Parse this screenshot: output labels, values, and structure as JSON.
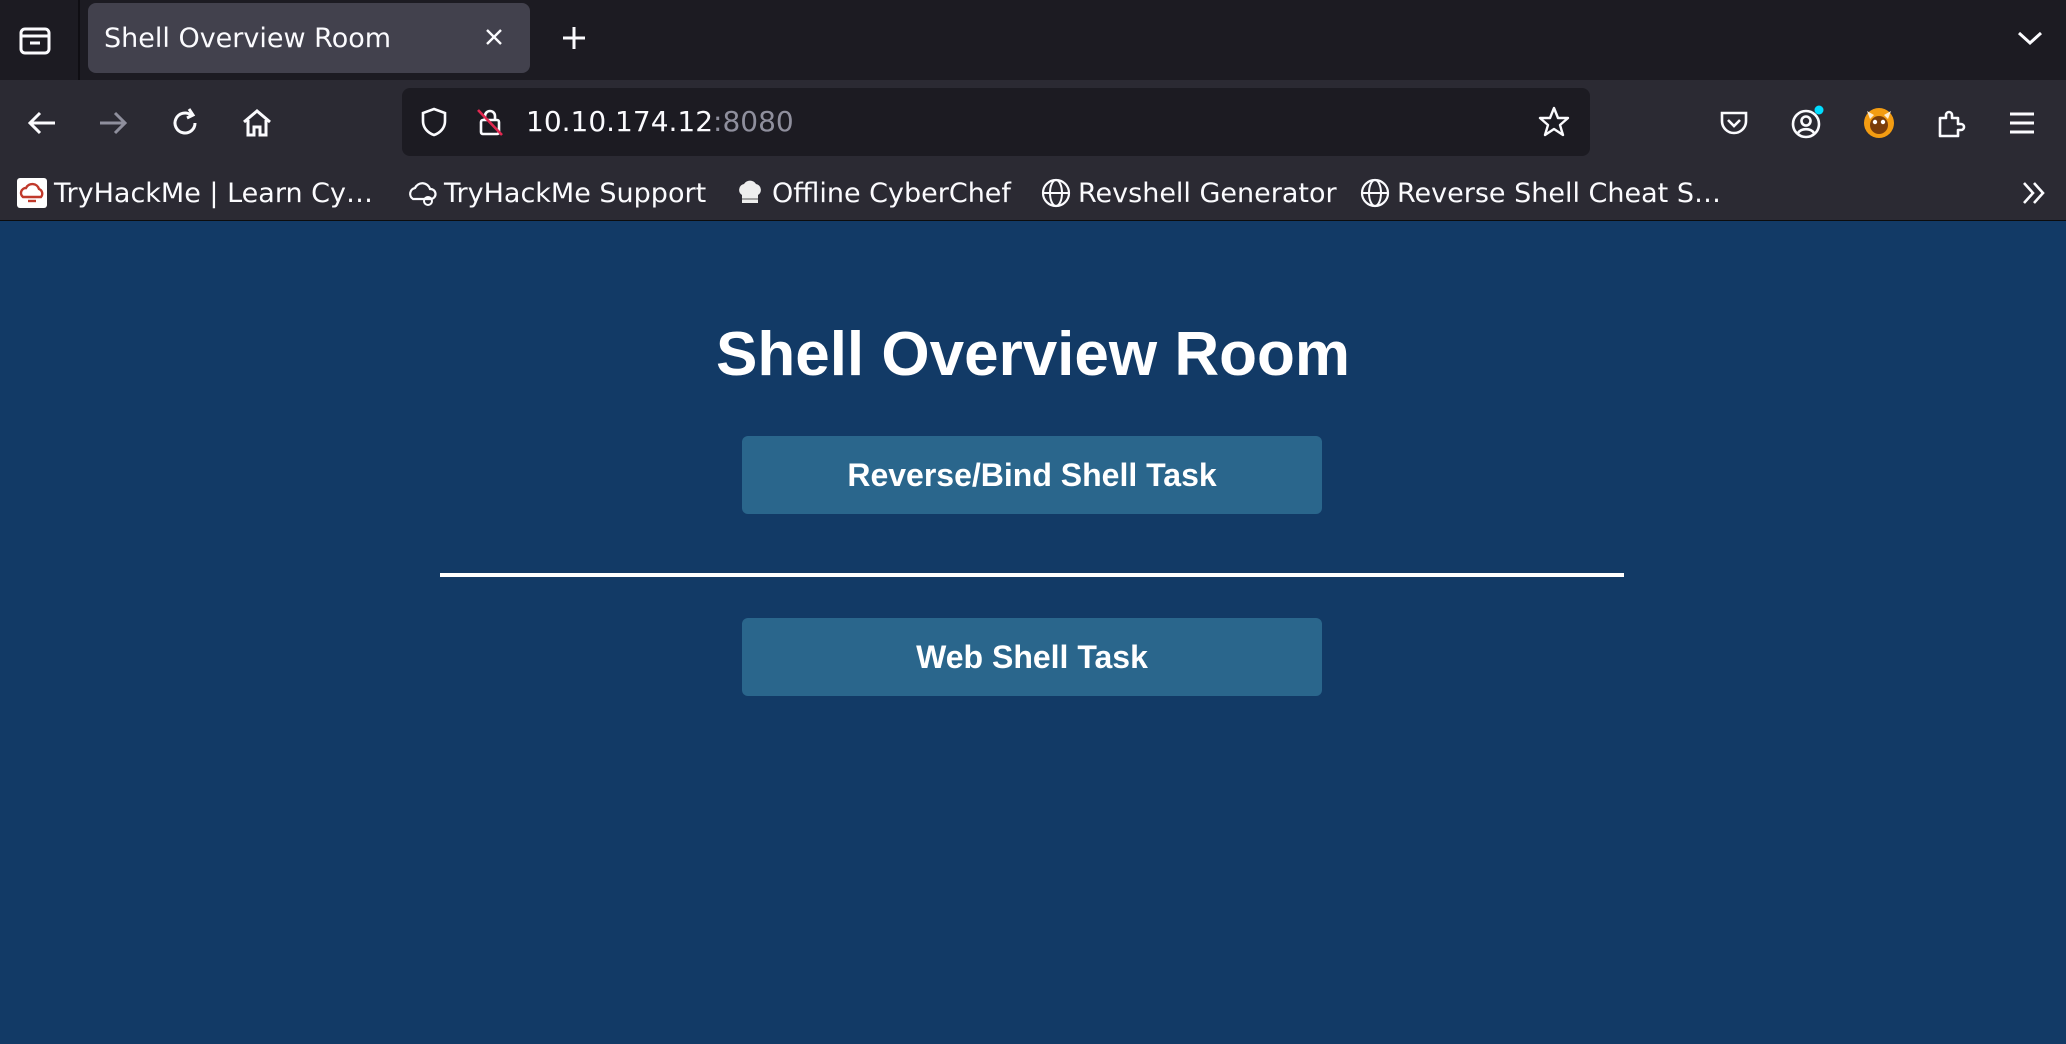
{
  "browser": {
    "tab": {
      "title": "Shell Overview Room"
    },
    "address": {
      "host": "10.10.174.12",
      "port": ":8080"
    },
    "bookmarks": [
      {
        "label": "TryHackMe | Learn Cy…",
        "icon": "tryhackme-icon"
      },
      {
        "label": "TryHackMe Support",
        "icon": "cloud-icon"
      },
      {
        "label": "Offline CyberChef",
        "icon": "chef-hat-icon"
      },
      {
        "label": "Revshell Generator",
        "icon": "globe-icon"
      },
      {
        "label": "Reverse Shell Cheat S…",
        "icon": "globe-icon"
      }
    ],
    "colors": {
      "toolbar": "#2b2a33",
      "tabstrip": "#1c1b22",
      "accent": "#0df"
    }
  },
  "page": {
    "title": "Shell Overview Room",
    "buttons": {
      "reverse_bind": "Reverse/Bind Shell Task",
      "web_shell": "Web Shell Task"
    },
    "colors": {
      "background": "#123a66",
      "button": "#2a668c"
    }
  }
}
